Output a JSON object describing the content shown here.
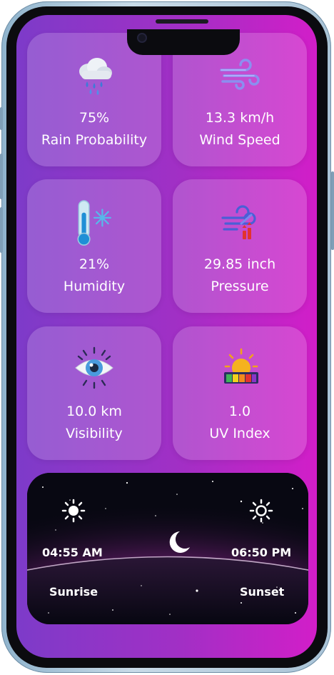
{
  "cards": [
    {
      "value": "75%",
      "label": "Rain Probability",
      "icon": "rain-cloud-icon"
    },
    {
      "value": "13.3 km/h",
      "label": "Wind Speed",
      "icon": "wind-icon"
    },
    {
      "value": "21%",
      "label": "Humidity",
      "icon": "thermometer-snow-icon"
    },
    {
      "value": "29.85 inch",
      "label": "Pressure",
      "icon": "pressure-wind-icon"
    },
    {
      "value": "10.0 km",
      "label": "Visibility",
      "icon": "eye-icon"
    },
    {
      "value": "1.0",
      "label": "UV Index",
      "icon": "uv-sun-icon"
    }
  ],
  "sun": {
    "sunrise_time": "04:55 AM",
    "sunset_time": "06:50 PM",
    "sunrise_label": "Sunrise",
    "sunset_label": "Sunset"
  },
  "colors": {
    "screen_left": "#7d3bc9",
    "screen_right": "#d21ec8",
    "card_bg": "rgba(255,255,255,0.18)",
    "horizon_glow": "#d02fc3"
  }
}
